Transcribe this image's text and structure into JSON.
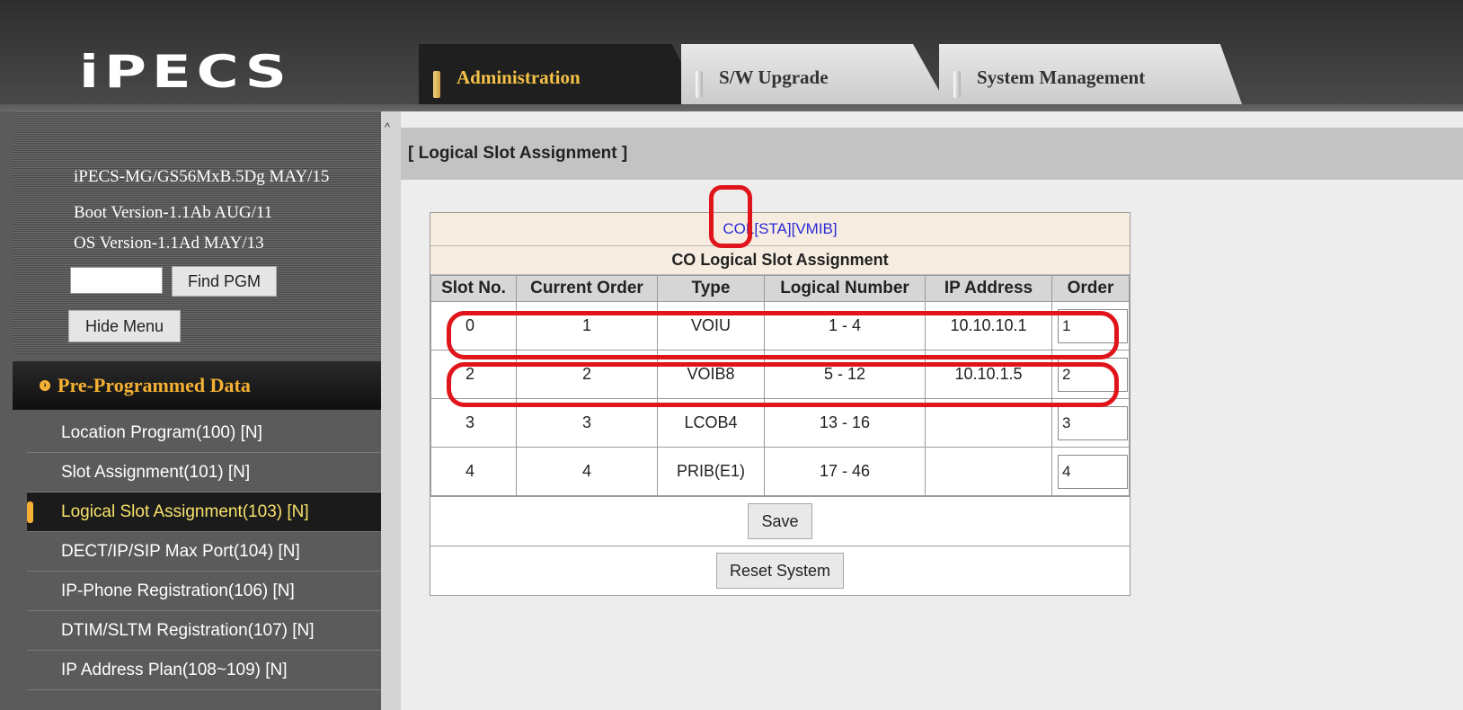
{
  "header": {
    "logo": "iPECS",
    "tabs": [
      {
        "label": "Administration",
        "active": true
      },
      {
        "label": "S/W Upgrade",
        "active": false
      },
      {
        "label": "System Management",
        "active": false
      }
    ]
  },
  "sidebar": {
    "versions": [
      "iPECS-MG/GS56MxB.5Dg MAY/15",
      "Boot Version-1.1Ab AUG/11",
      "OS Version-1.1Ad MAY/13"
    ],
    "find_input_value": "",
    "find_button": "Find PGM",
    "hide_button": "Hide Menu",
    "section_title": "Pre-Programmed Data",
    "items": [
      {
        "label": "Location Program(100) [N]",
        "active": false
      },
      {
        "label": "Slot Assignment(101) [N]",
        "active": false
      },
      {
        "label": "Logical Slot Assignment(103) [N]",
        "active": true
      },
      {
        "label": "DECT/IP/SIP Max Port(104) [N]",
        "active": false
      },
      {
        "label": "IP-Phone Registration(106) [N]",
        "active": false
      },
      {
        "label": "DTIM/SLTM Registration(107) [N]",
        "active": false
      },
      {
        "label": "IP Address Plan(108~109) [N]",
        "active": false
      }
    ]
  },
  "main": {
    "page_title": "[ Logical Slot Assignment ]",
    "links": [
      "COL",
      "[STA]",
      "[VMIB]"
    ],
    "table_caption": "CO Logical Slot Assignment",
    "columns": [
      "Slot No.",
      "Current Order",
      "Type",
      "Logical Number",
      "IP Address",
      "Order"
    ],
    "rows": [
      {
        "slot": "0",
        "current_order": "1",
        "type": "VOIU",
        "logical_number": "1 - 4",
        "ip": "10.10.10.1",
        "order": "1"
      },
      {
        "slot": "2",
        "current_order": "2",
        "type": "VOIB8",
        "logical_number": "5 - 12",
        "ip": "10.10.1.5",
        "order": "2"
      },
      {
        "slot": "3",
        "current_order": "3",
        "type": "LCOB4",
        "logical_number": "13 - 16",
        "ip": "",
        "order": "3"
      },
      {
        "slot": "4",
        "current_order": "4",
        "type": "PRIB(E1)",
        "logical_number": "17 - 46",
        "ip": "",
        "order": "4"
      }
    ],
    "save_button": "Save",
    "reset_button": "Reset System"
  },
  "colors": {
    "accent": "#f5b133",
    "annotation": "#e0151b",
    "link": "#2b2bd6"
  }
}
